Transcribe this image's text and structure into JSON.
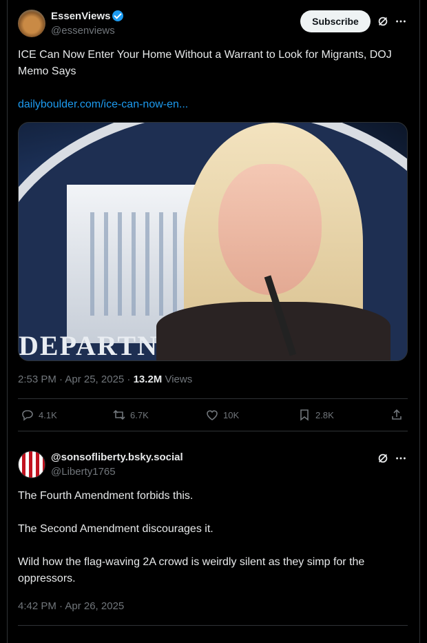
{
  "post": {
    "author_name": "EssenViews",
    "author_handle": "@essenviews",
    "subscribe_label": "Subscribe",
    "text": "ICE Can Now Enter Your Home Without a Warrant to Look for Migrants, DOJ Memo Says",
    "link_text": "dailyboulder.com/ice-can-now-en...",
    "image_text": "DEPARTN",
    "timestamp": "2:53 PM · Apr 25, 2025 · ",
    "views_count": "13.2M",
    "views_label": " Views",
    "actions": {
      "replies": "4.1K",
      "reposts": "6.7K",
      "likes": "10K",
      "bookmarks": "2.8K"
    }
  },
  "reply": {
    "author_name": "@sonsofliberty.bsky.social",
    "author_handle": "@Liberty1765",
    "line1": "The Fourth Amendment forbids this.",
    "line2": "The Second Amendment discourages it.",
    "line3": "Wild how the flag-waving 2A crowd is weirdly silent as they simp for the oppressors.",
    "timestamp": "4:42 PM · Apr 26, 2025"
  },
  "icons": {
    "verified": "verified-badge-icon",
    "grok": "grok-icon",
    "more": "more-icon",
    "reply": "reply-icon",
    "repost": "repost-icon",
    "like": "heart-icon",
    "bookmark": "bookmark-icon",
    "share": "share-icon"
  },
  "colors": {
    "background": "#000000",
    "text": "#e7e9ea",
    "muted": "#71767b",
    "link": "#1d9bf0",
    "divider": "#2f3336"
  }
}
